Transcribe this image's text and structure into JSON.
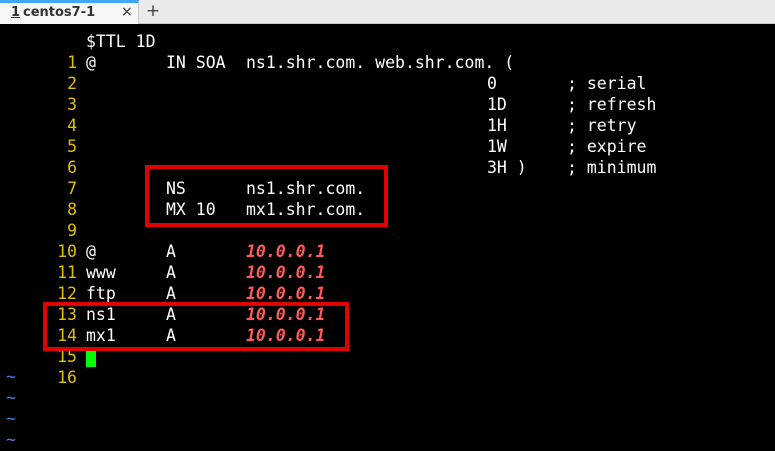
{
  "tab": {
    "number": "1",
    "title": "centos7-1",
    "close": "×"
  },
  "newtab_symbol": "+",
  "lines": [
    {
      "n": "1",
      "c": [
        "$TTL 1D"
      ]
    },
    {
      "n": "2",
      "c": [
        "@",
        "IN SOA",
        "ns1.shr.com. web.shr.com. ("
      ]
    },
    {
      "n": "3",
      "val": "0",
      "comment": "; serial"
    },
    {
      "n": "4",
      "val": "1D",
      "comment": "; refresh"
    },
    {
      "n": "5",
      "val": "1H",
      "comment": "; retry"
    },
    {
      "n": "6",
      "val": "1W",
      "comment": "; expire"
    },
    {
      "n": "7",
      "val": "3H )",
      "comment": "; minimum"
    },
    {
      "n": "8",
      "type": "NS",
      "target": "ns1.shr.com."
    },
    {
      "n": "9",
      "type": "MX 10",
      "target": "mx1.shr.com."
    },
    {
      "n": "10"
    },
    {
      "n": "11",
      "name": "@",
      "type": "A",
      "ip": "10.0.0.1"
    },
    {
      "n": "12",
      "name": "www",
      "type": "A",
      "ip": "10.0.0.1"
    },
    {
      "n": "13",
      "name": "ftp",
      "type": "A",
      "ip": "10.0.0.1"
    },
    {
      "n": "14",
      "name": "ns1",
      "type": "A",
      "ip": "10.0.0.1"
    },
    {
      "n": "15",
      "name": "mx1",
      "type": "A",
      "ip": "10.0.0.1"
    },
    {
      "n": "16"
    }
  ],
  "tildes": [
    "~",
    "~",
    "~",
    "~"
  ],
  "colors": {
    "line_number": "#e0c000",
    "ip_address": "#ff5a5a",
    "cursor": "#00ff00",
    "highlight_box": "#e00000",
    "tilde": "#4a7fe0"
  }
}
